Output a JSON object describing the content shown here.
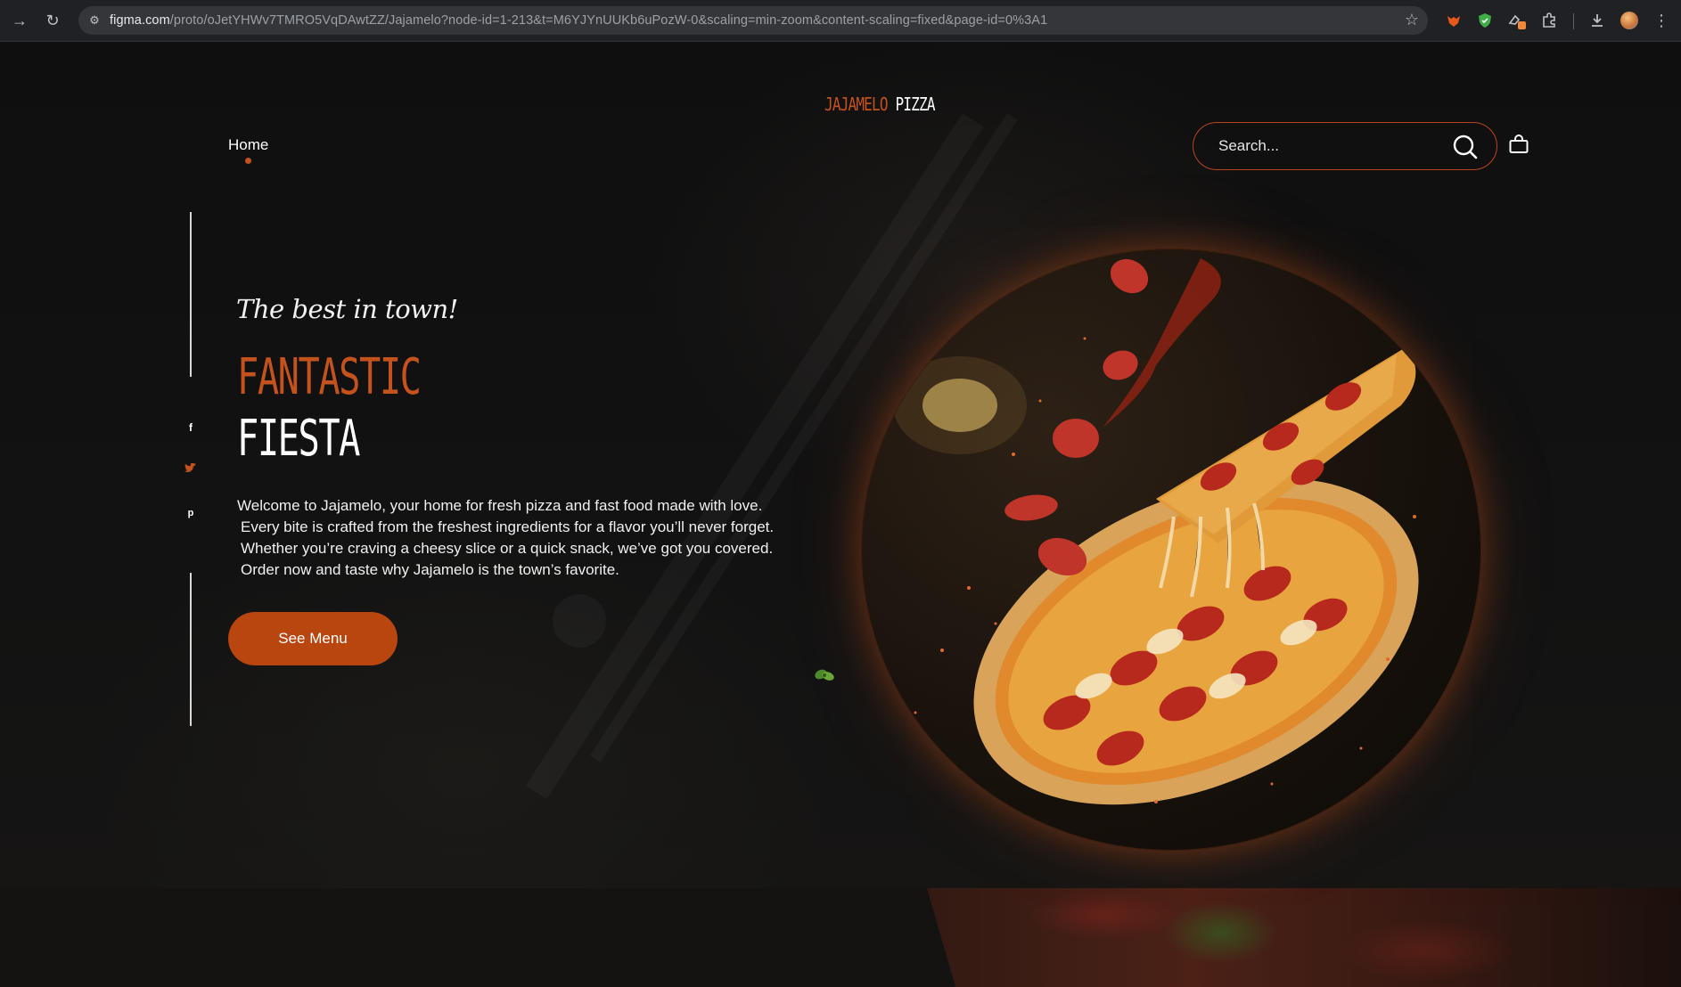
{
  "browser": {
    "url_host": "figma.com",
    "url_path": "/proto/oJetYHWv7TMRO5VqDAwtZZ/Jajamelo?node-id=1-213&t=M6YJYnUUKb6uPozW-0&scaling=min-zoom&content-scaling=fixed&page-id=0%3A1"
  },
  "header": {
    "logo_part1": "JAJAMELO",
    "logo_part2": "PIZZA",
    "nav_home": "Home",
    "search_placeholder": "Search..."
  },
  "hero": {
    "tagline": "The best in town!",
    "title_line1": "FANTASTIC",
    "title_line2": "FIESTA",
    "description": [
      "Welcome to Jajamelo, your home for fresh pizza and fast food made with love.",
      "Every bite is crafted from the freshest ingredients for a flavor you’ll never forget.",
      "Whether you’re craving a cheesy slice or a quick snack, we’ve got you covered.",
      "Order now and taste why Jajamelo is the town’s favorite."
    ],
    "cta_label": "See Menu"
  },
  "social": {
    "facebook": "f",
    "twitter_icon": "twitter-icon",
    "pinterest": "p"
  },
  "colors": {
    "accent": "#c4521d",
    "button": "#b8460e",
    "background": "#0b0b0b"
  }
}
